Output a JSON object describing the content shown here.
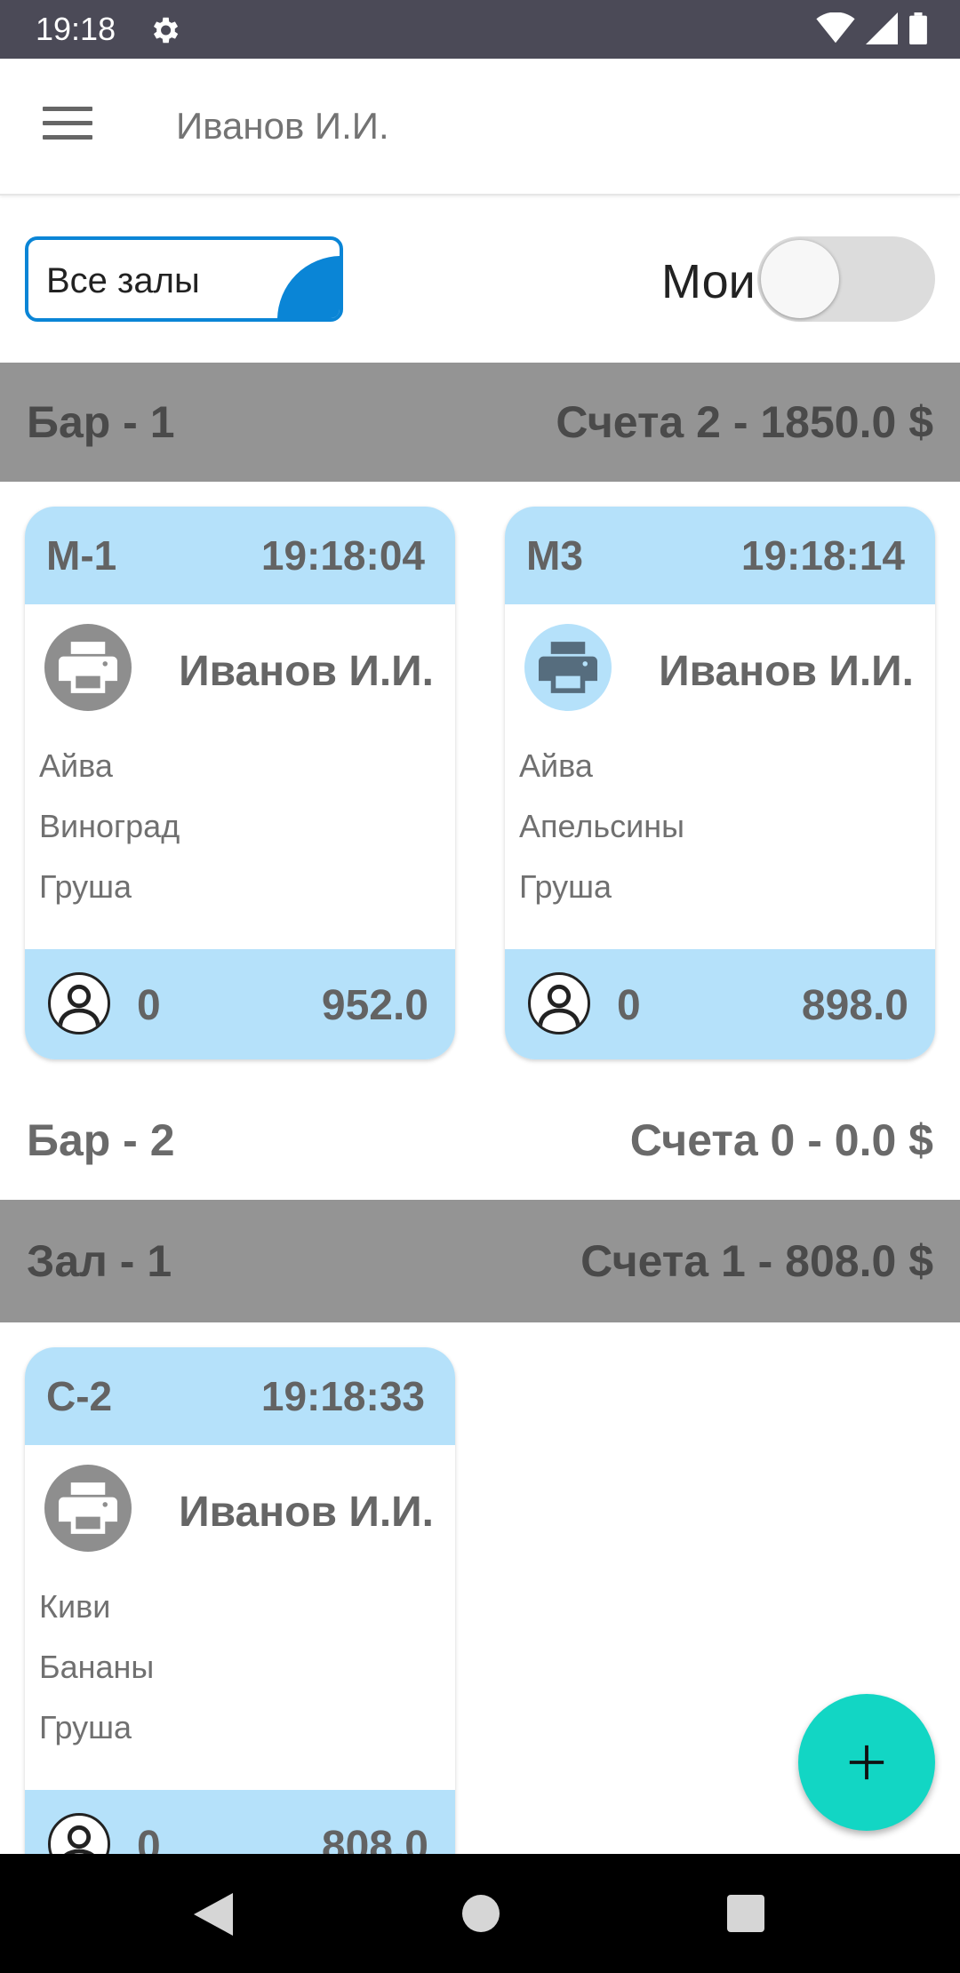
{
  "status_bar": {
    "time": "19:18"
  },
  "app_bar": {
    "title": "Иванов И.И."
  },
  "filter": {
    "hall_select_value": "Все залы",
    "mine_label": "Мои",
    "mine_toggle_on": false
  },
  "sections": [
    {
      "name": "Бар - 1",
      "summary": "Счета 2 - 1850.0 $"
    },
    {
      "name": "Бар - 2",
      "summary": "Счета 0 - 0.0 $"
    },
    {
      "name": "Зал - 1",
      "summary": "Счета 1 - 808.0 $"
    }
  ],
  "cards": [
    {
      "table": "М-1",
      "time": "19:18:04",
      "waiter": "Иванов И.И.",
      "printed": false,
      "items": [
        "Айва",
        "Виноград",
        "Груша"
      ],
      "guests": "0",
      "total": "952.0"
    },
    {
      "table": "М3",
      "time": "19:18:14",
      "waiter": "Иванов И.И.",
      "printed": true,
      "items": [
        "Айва",
        "Апельсины",
        "Груша"
      ],
      "guests": "0",
      "total": "898.0"
    },
    {
      "table": "С-2",
      "time": "19:18:33",
      "waiter": "Иванов И.И.",
      "printed": false,
      "items": [
        "Киви",
        "Бананы",
        "Груша"
      ],
      "guests": "0",
      "total": "808.0"
    }
  ],
  "colors": {
    "accent": "#0a85d6",
    "card_header": "#b5e1fa",
    "section_gray": "#949494",
    "fab": "#12d6c4",
    "status_bar": "#4b4a57"
  },
  "icons": {
    "menu": "hamburger-menu-icon",
    "printer": "printer-icon",
    "guest": "person-icon",
    "fab": "plus-icon"
  }
}
